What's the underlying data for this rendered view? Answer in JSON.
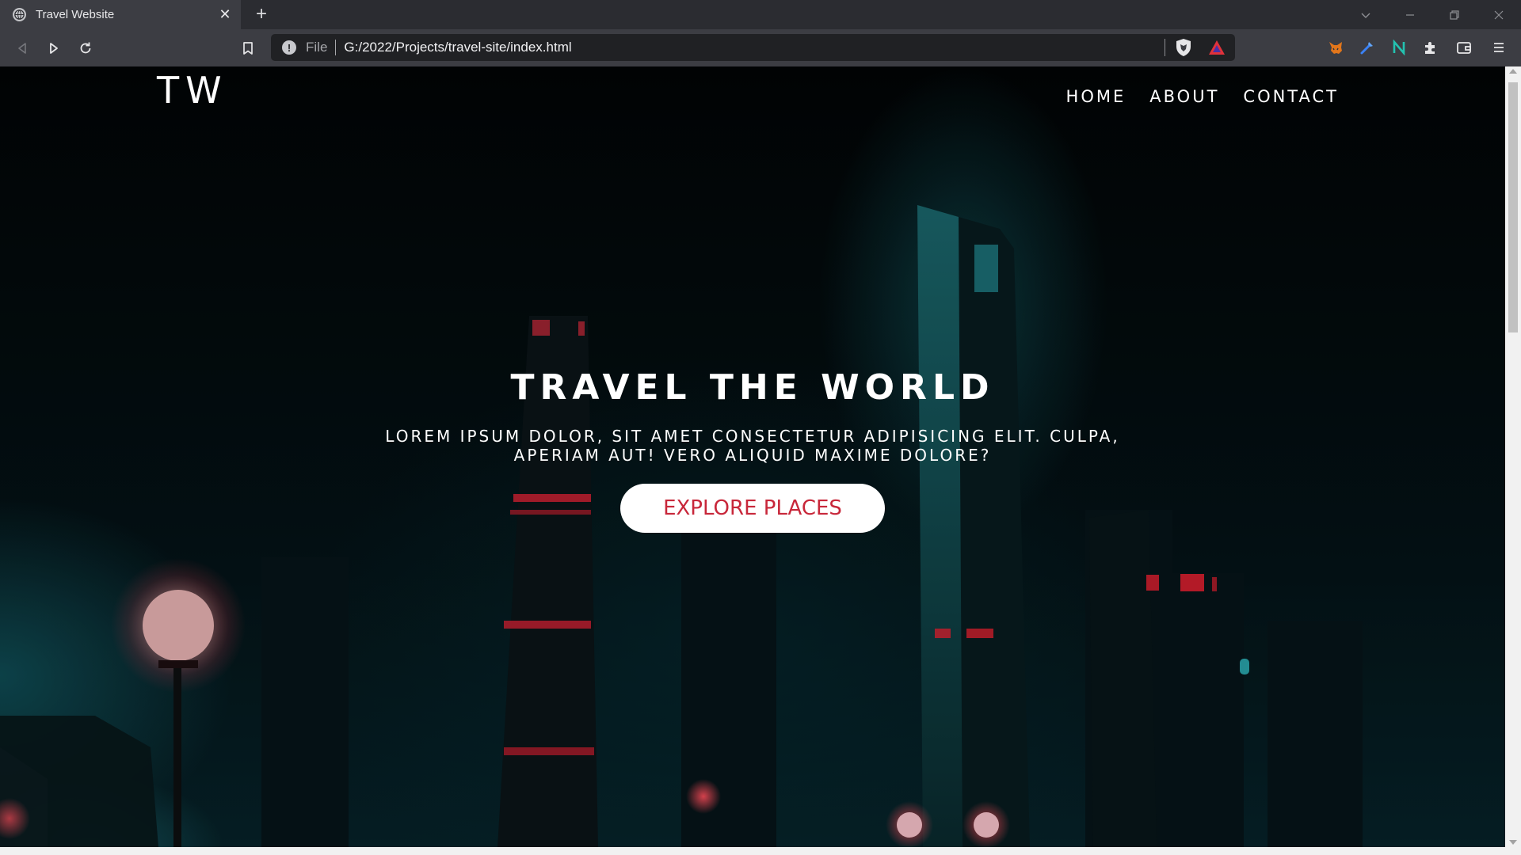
{
  "browser": {
    "tab_title": "Travel Website",
    "omnibox": {
      "scheme_label": "File",
      "url": "G:/2022/Projects/travel-site/index.html"
    },
    "icons": {
      "favicon": "globe-icon",
      "back": "back-arrow-icon",
      "forward": "forward-play-icon",
      "reload": "reload-icon",
      "bookmark": "bookmark-icon",
      "site_info": "info-icon",
      "brave_shield": "brave-shield-icon",
      "rewards": "bat-triangle-icon",
      "extensions": [
        "metamask-fox-icon",
        "blue-tool-icon",
        "teal-n-icon",
        "puzzle-icon",
        "wallet-icon",
        "menu-icon"
      ]
    }
  },
  "site": {
    "logo": "TW",
    "nav": {
      "home": "HOME",
      "about": "ABOUT",
      "contact": "CONTACT"
    },
    "hero": {
      "title": "TRAVEL THE WORLD",
      "subtitle": "LOREM IPSUM DOLOR, SIT AMET CONSECTETUR ADIPISICING ELIT. CULPA, APERIAM AUT! VERO ALIQUID MAXIME DOLORE?",
      "button": "EXPLORE PLACES"
    },
    "colors": {
      "button_text": "#c8273a",
      "button_bg": "#ffffff",
      "accent_teal": "#1e7882",
      "neon_red": "#d81f2e"
    }
  }
}
